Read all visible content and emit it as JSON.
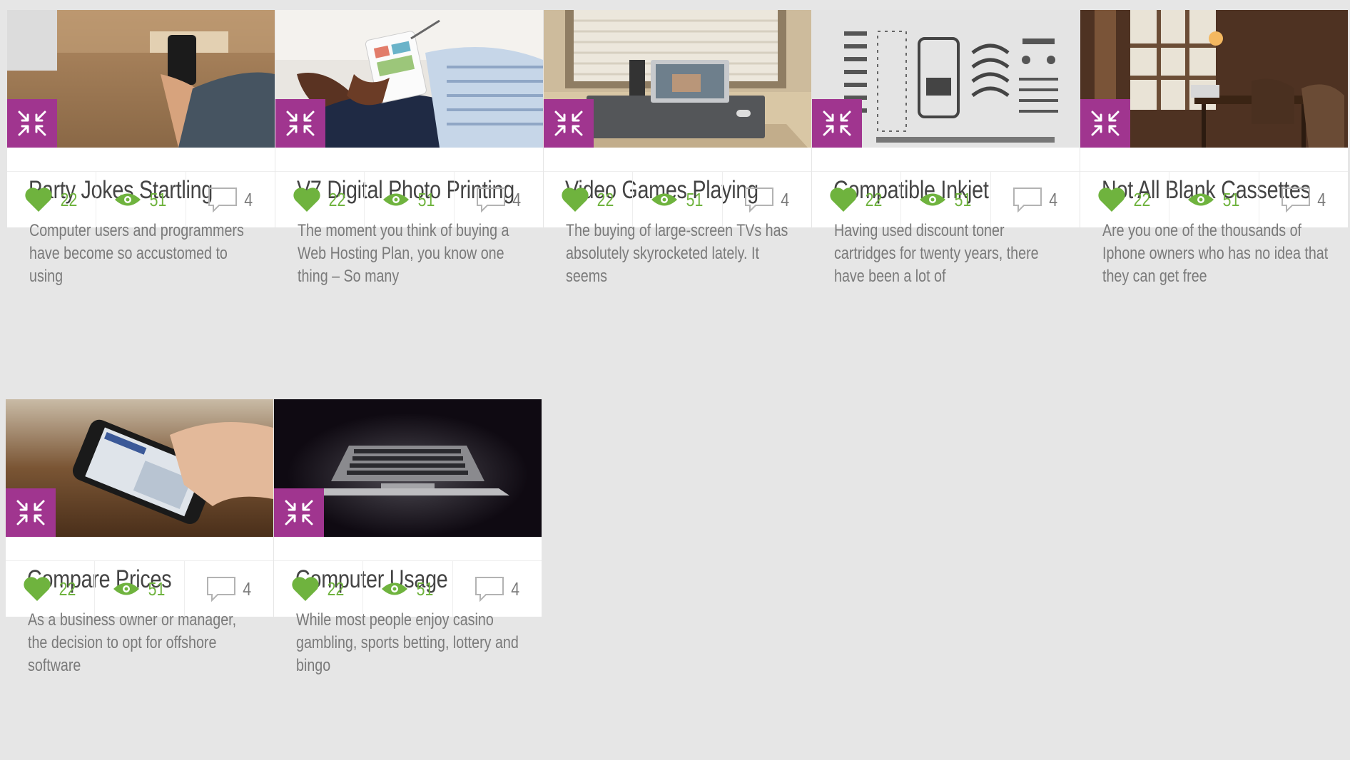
{
  "accent_color": "#a0358f",
  "stat_color": "#6fb33e",
  "badge_icon": "collapse-arrows-icon",
  "cards": [
    {
      "title": "Party Jokes Startling",
      "description": "Computer users and programmers have become so accustomed to using",
      "likes": "22",
      "views": "51",
      "comments": "4",
      "image": "hand-holding-phone-on-wooden-desk"
    },
    {
      "title": "V7 Digital Photo Printing",
      "description": "The moment you think of buying a Web Hosting Plan, you know one thing – So many",
      "likes": "22",
      "views": "51",
      "comments": "4",
      "image": "man-using-tablet-with-stylus"
    },
    {
      "title": "Video Games Playing",
      "description": "The buying of large-screen TVs has absolutely skyrocketed lately. It seems",
      "likes": "22",
      "views": "51",
      "comments": "4",
      "image": "laptop-on-desk-by-window"
    },
    {
      "title": "Compatible Inkjet",
      "description": "Having used discount toner cartridges for twenty years, there have been a lot of",
      "likes": "22",
      "views": "51",
      "comments": "4",
      "image": "ui-kit-sketch-sheet"
    },
    {
      "title": "Not All Blank Cassettes",
      "description": "Are you one of the thousands of Iphone owners who has no idea that they can get free",
      "likes": "22",
      "views": "51",
      "comments": "4",
      "image": "cafe-interior-with-laptop"
    },
    {
      "title": "Compare Prices",
      "description": "As a business owner or manager, the decision to opt for offshore software",
      "likes": "22",
      "views": "51",
      "comments": "4",
      "image": "hand-holding-smartphone"
    },
    {
      "title": "Computer Usage",
      "description": "While most people enjoy casino gambling, sports betting, lottery and bingo",
      "likes": "22",
      "views": "51",
      "comments": "4",
      "image": "laptop-keyboard-in-dark"
    }
  ]
}
